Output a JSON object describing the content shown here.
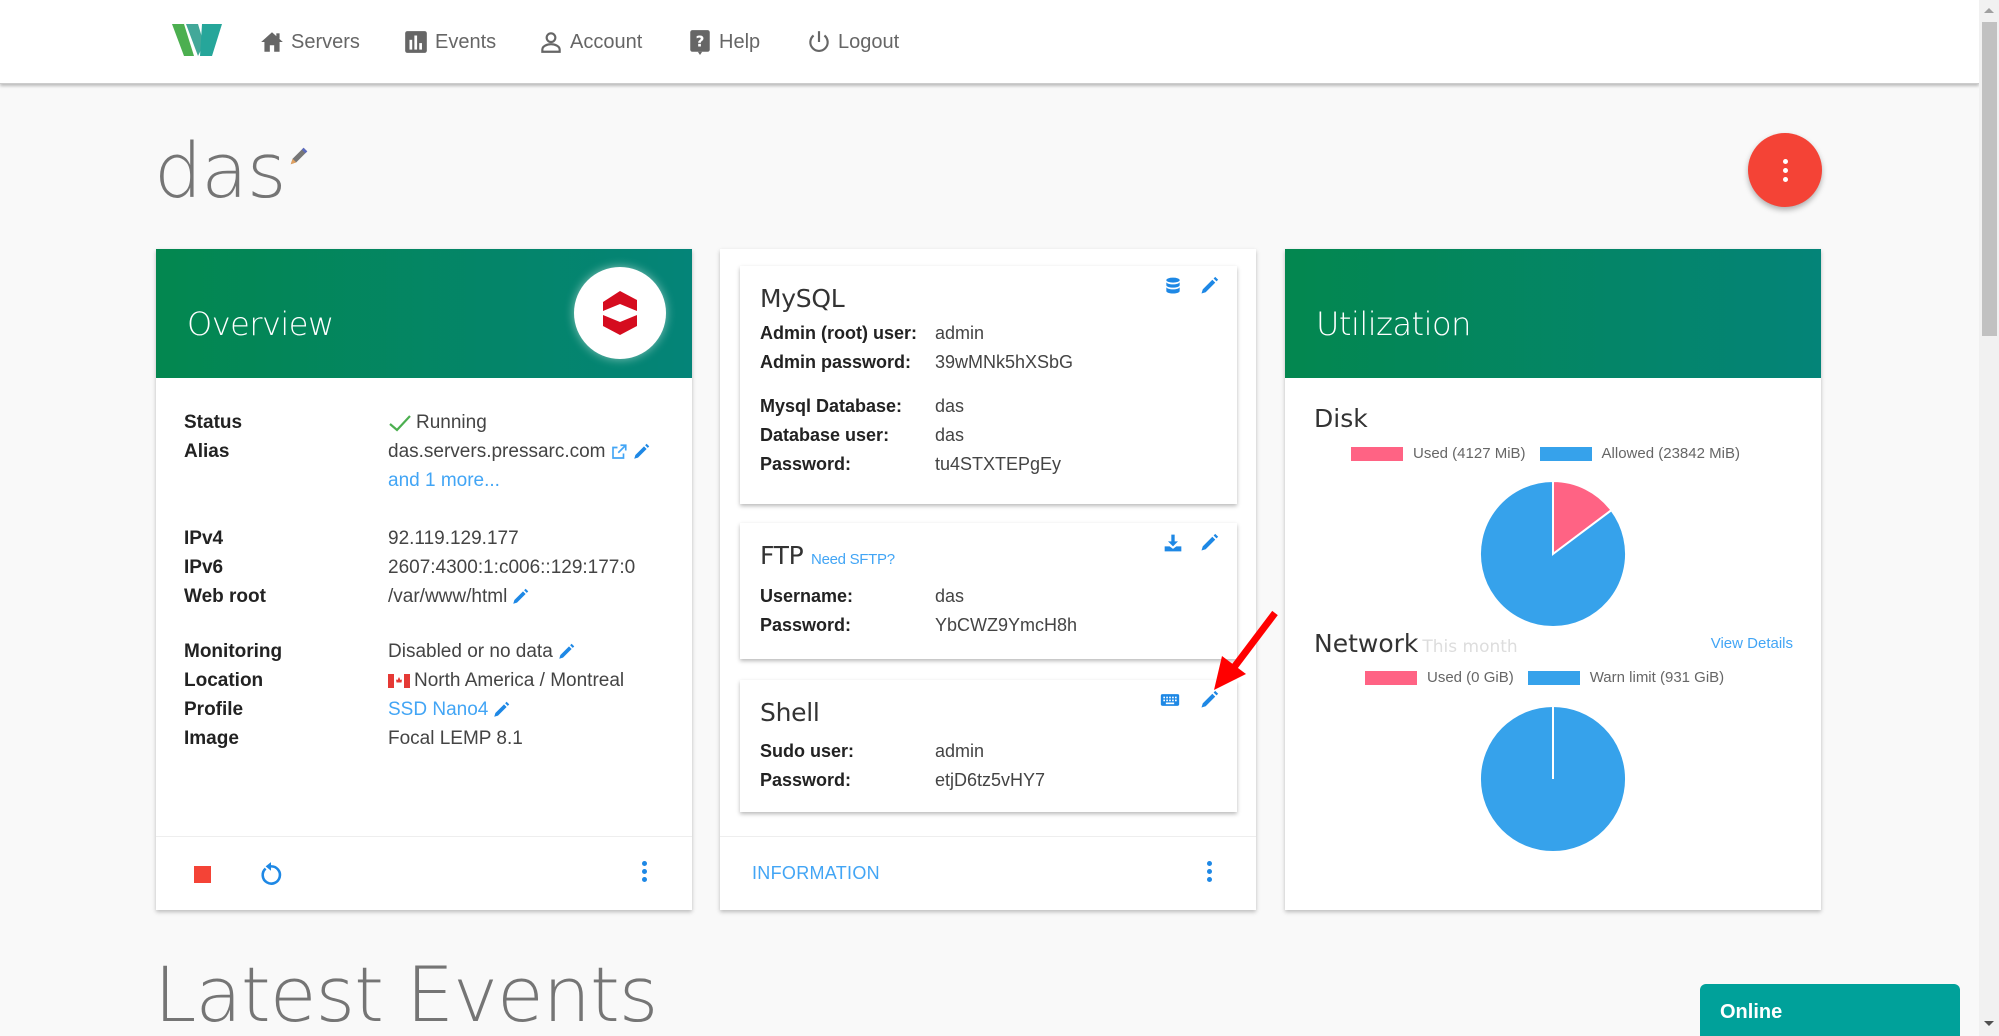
{
  "nav": {
    "items": [
      {
        "label": "Servers",
        "icon": "home-icon"
      },
      {
        "label": "Events",
        "icon": "bar-chart-icon"
      },
      {
        "label": "Account",
        "icon": "user-icon"
      },
      {
        "label": "Help",
        "icon": "help-icon"
      },
      {
        "label": "Logout",
        "icon": "power-icon"
      }
    ]
  },
  "server": {
    "name": "das"
  },
  "overview": {
    "title": "Overview",
    "status": {
      "label": "Status",
      "value": "Running"
    },
    "alias": {
      "label": "Alias",
      "value": "das.servers.pressarc.com",
      "more": "and 1 more..."
    },
    "ipv4": {
      "label": "IPv4",
      "value": "92.119.129.177"
    },
    "ipv6": {
      "label": "IPv6",
      "value": "2607:4300:1:c006::129:177:0"
    },
    "webroot": {
      "label": "Web root",
      "value": "/var/www/html"
    },
    "monitoring": {
      "label": "Monitoring",
      "value": "Disabled or no data"
    },
    "location": {
      "label": "Location",
      "value": "North America / Montreal"
    },
    "profile": {
      "label": "Profile",
      "value": "SSD Nano4"
    },
    "image": {
      "label": "Image",
      "value": "Focal LEMP 8.1"
    }
  },
  "mysql": {
    "title": "MySQL",
    "rows": [
      {
        "label": "Admin (root) user:",
        "value": "admin"
      },
      {
        "label": "Admin password:",
        "value": "39wMNk5hXSbG"
      },
      {
        "label": "Mysql Database:",
        "value": "das"
      },
      {
        "label": "Database user:",
        "value": "das"
      },
      {
        "label": "Password:",
        "value": "tu4STXTEPgEy"
      }
    ]
  },
  "ftp": {
    "title": "FTP",
    "sftp_link": "Need SFTP?",
    "rows": [
      {
        "label": "Username:",
        "value": "das"
      },
      {
        "label": "Password:",
        "value": "YbCWZ9YmcH8h"
      }
    ]
  },
  "shell": {
    "title": "Shell",
    "rows": [
      {
        "label": "Sudo user:",
        "value": "admin"
      },
      {
        "label": "Password:",
        "value": "etjD6tz5vHY7"
      }
    ]
  },
  "middle_footer": {
    "information_label": "INFORMATION"
  },
  "utilization": {
    "title": "Utilization",
    "disk": {
      "title": "Disk",
      "legend_used": "Used (4127 MiB)",
      "legend_allowed": "Allowed (23842 MiB)"
    },
    "network": {
      "title": "Network",
      "subtitle": "This month",
      "view_details": "View Details",
      "legend_used": "Used (0 GiB)",
      "legend_limit": "Warn limit (931 GiB)"
    },
    "colors": {
      "used": "#ff6384",
      "allowed": "#36a2eb"
    }
  },
  "chart_data": [
    {
      "type": "pie",
      "title": "Disk",
      "categories": [
        "Used (4127 MiB)",
        "Allowed (23842 MiB)"
      ],
      "values": [
        4127,
        23842
      ],
      "colors": [
        "#ff6384",
        "#36a2eb"
      ],
      "legend": "top"
    },
    {
      "type": "pie",
      "title": "Network",
      "categories": [
        "Used (0 GiB)",
        "Warn limit (931 GiB)"
      ],
      "values": [
        0,
        931
      ],
      "colors": [
        "#ff6384",
        "#36a2eb"
      ],
      "legend": "top"
    }
  ],
  "events": {
    "title": "Latest Events"
  },
  "chat": {
    "status": "Online"
  },
  "colors": {
    "header_gradient_start": "#03874f",
    "header_gradient_end": "#048478",
    "accent_blue": "#42a5f5",
    "danger": "#f44336",
    "online": "#00a19a"
  }
}
